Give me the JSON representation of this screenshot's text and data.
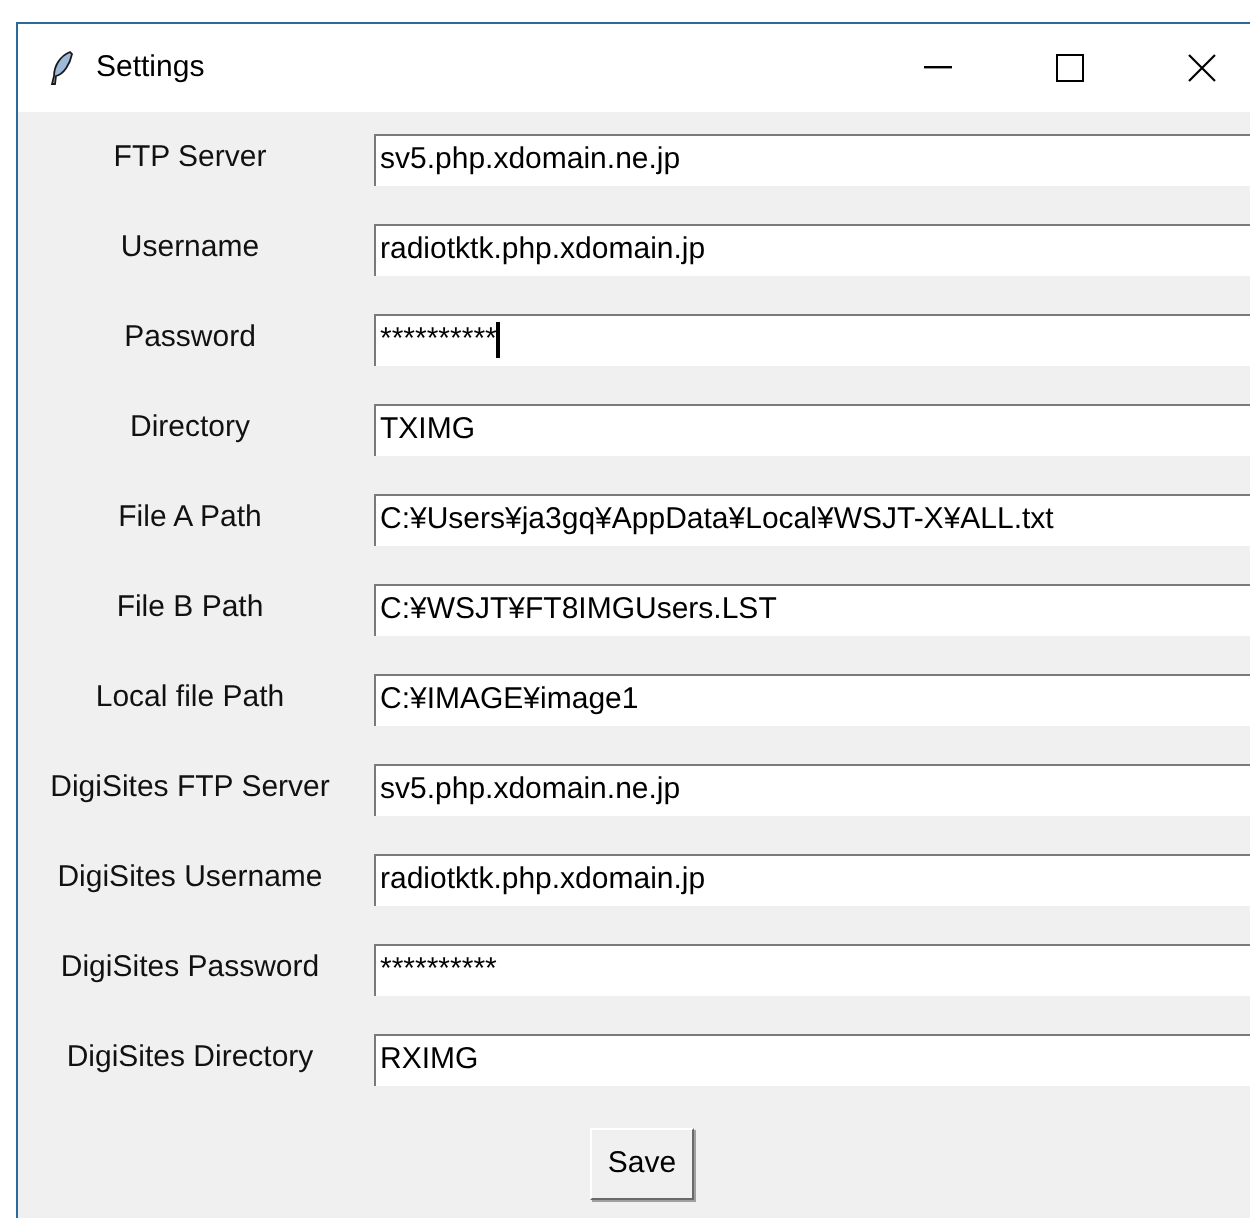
{
  "window": {
    "title": "Settings"
  },
  "fields": [
    {
      "label": "FTP Server",
      "value": "sv5.php.xdomain.ne.jp",
      "focused": false
    },
    {
      "label": "Username",
      "value": "radiotktk.php.xdomain.jp",
      "focused": false
    },
    {
      "label": "Password",
      "value": "**********",
      "focused": true
    },
    {
      "label": "Directory",
      "value": "TXIMG",
      "focused": false
    },
    {
      "label": "File A Path",
      "value": "C:¥Users¥ja3gq¥AppData¥Local¥WSJT-X¥ALL.txt",
      "focused": false
    },
    {
      "label": "File B Path",
      "value": "C:¥WSJT¥FT8IMGUsers.LST",
      "focused": false
    },
    {
      "label": "Local file Path",
      "value": "C:¥IMAGE¥image1",
      "focused": false
    },
    {
      "label": "DigiSites FTP Server",
      "value": "sv5.php.xdomain.ne.jp",
      "focused": false
    },
    {
      "label": "DigiSites Username",
      "value": "radiotktk.php.xdomain.jp",
      "focused": false
    },
    {
      "label": "DigiSites Password",
      "value": "**********",
      "focused": false
    },
    {
      "label": "DigiSites Directory",
      "value": "RXIMG",
      "focused": false
    }
  ],
  "buttons": [
    "Save"
  ]
}
